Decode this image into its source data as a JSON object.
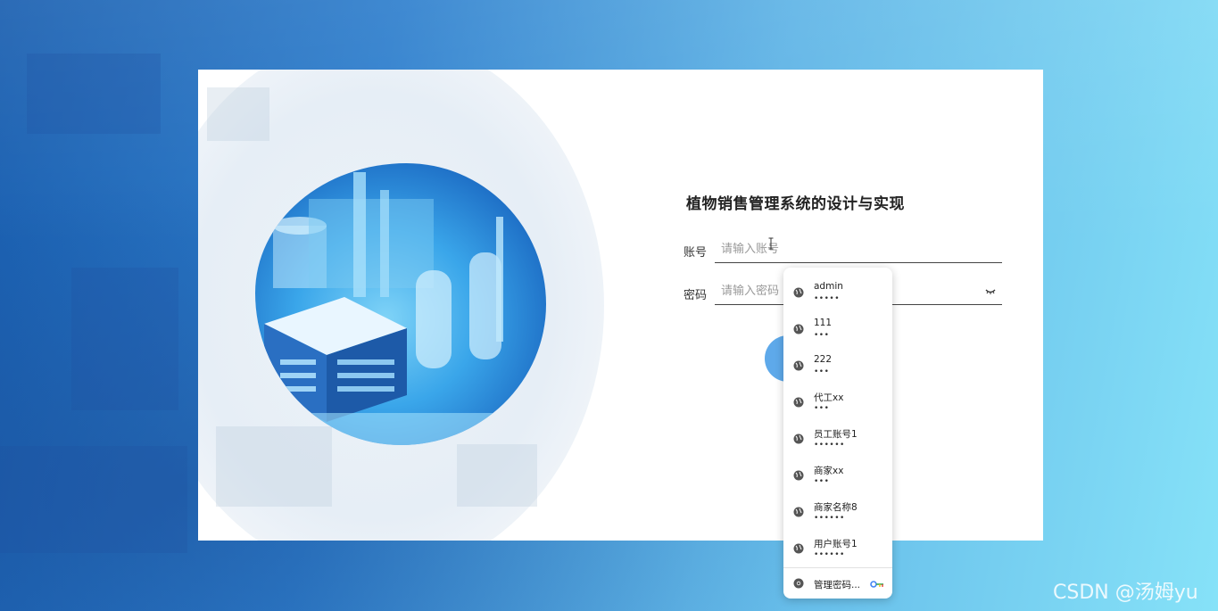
{
  "app": {
    "title": "植物销售管理系统的设计与实现"
  },
  "form": {
    "account_label": "账号",
    "account_placeholder": "请输入账号",
    "password_label": "密码",
    "password_placeholder": "请输入密码"
  },
  "autofill": {
    "items": [
      {
        "username": "admin",
        "password_mask": "•••••"
      },
      {
        "username": "111",
        "password_mask": "•••"
      },
      {
        "username": "222",
        "password_mask": "•••"
      },
      {
        "username": "代工xx",
        "password_mask": "•••"
      },
      {
        "username": "员工账号1",
        "password_mask": "••••••"
      },
      {
        "username": "商家xx",
        "password_mask": "•••"
      },
      {
        "username": "商家名称8",
        "password_mask": "••••••"
      },
      {
        "username": "用户账号1",
        "password_mask": "••••••"
      }
    ],
    "manage_label": "管理密码..."
  },
  "watermark": "CSDN @汤姆yu",
  "colors": {
    "accent": "#5ea9ea",
    "background_start": "#1a5fb0",
    "background_end": "#86e2f8"
  },
  "icons": [
    "globe-icon",
    "chrome-icon",
    "key-icon",
    "eye-closed-icon"
  ]
}
